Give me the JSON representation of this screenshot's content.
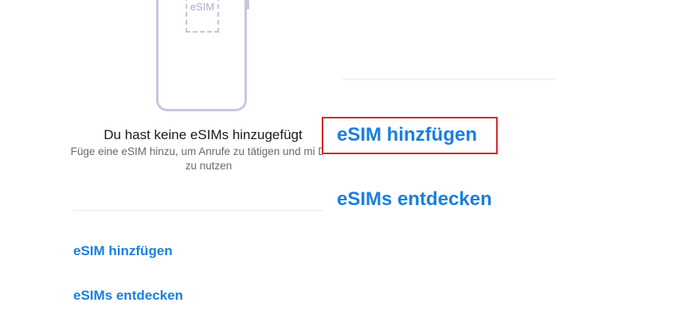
{
  "illustration": {
    "chip_label": "eSIM"
  },
  "empty_state": {
    "title": "Du hast keine eSIMs hinzugefügt",
    "subtitle": "Füge eine eSIM hinzu, um Anrufe zu tätigen und mi Daten zu nutzen"
  },
  "actions": {
    "add_esim_label": "eSIM hinzfügen",
    "discover_esims_label": "eSIMs entdecken"
  },
  "zoom": {
    "add_esim_label": "eSIM hinzfügen",
    "discover_esims_label": "eSIMs entdecken"
  },
  "colors": {
    "link": "#1a7fe0",
    "highlight": "#d62828",
    "illustration": "#c3c8dc"
  }
}
